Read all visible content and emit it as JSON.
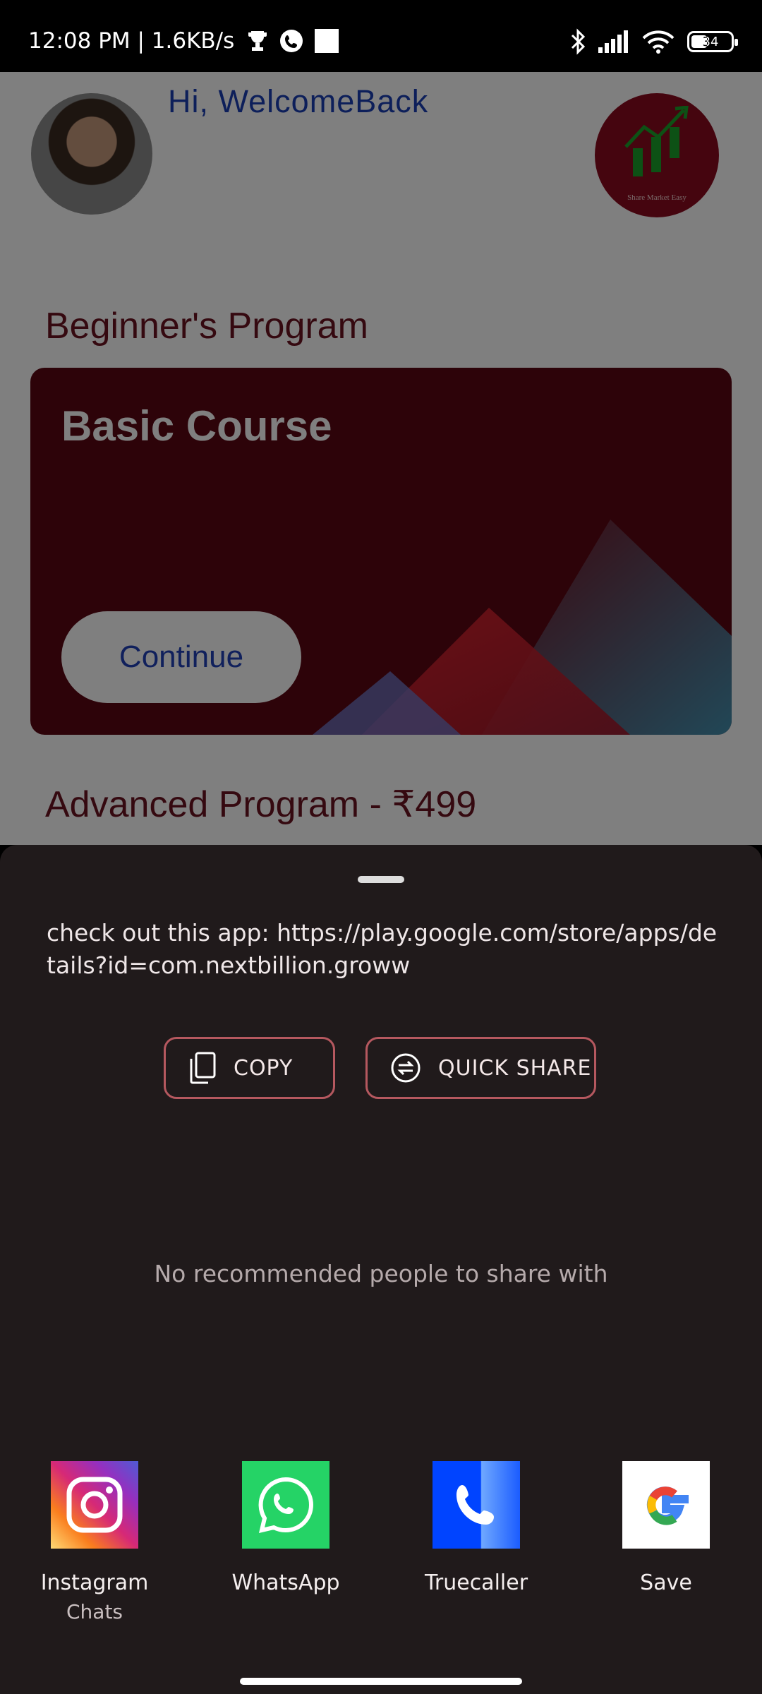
{
  "status_bar": {
    "time_speed": "12:08 PM | 1.6KB/s",
    "battery": "34",
    "icons": [
      "trophy-icon",
      "phone-app-icon",
      "square-icon",
      "bluetooth-icon",
      "signal-icon",
      "wifi-icon",
      "battery-icon"
    ]
  },
  "app": {
    "greeting": "Hi, WelcomeBack",
    "logo_text": "Share Market Easy",
    "beginner_title": "Beginner's Program",
    "card_title": "Basic Course",
    "continue_label": "Continue",
    "advanced_title": "Advanced Program - ₹499",
    "colors": {
      "brand": "#5b0612",
      "accent": "#2040b8"
    }
  },
  "share_sheet": {
    "text": "check out this app: https://play.google.com/store/apps/details?id=com.nextbillion.groww",
    "copy_label": "COPY",
    "quick_share_label": "QUICK SHARE",
    "no_people": "No recommended people to share with",
    "apps": [
      {
        "label": "Instagram",
        "sub": "Chats",
        "icon": "instagram-icon"
      },
      {
        "label": "WhatsApp",
        "sub": "",
        "icon": "whatsapp-icon"
      },
      {
        "label": "Truecaller",
        "sub": "",
        "icon": "truecaller-icon"
      },
      {
        "label": "Save",
        "sub": "",
        "icon": "google-icon"
      }
    ]
  }
}
